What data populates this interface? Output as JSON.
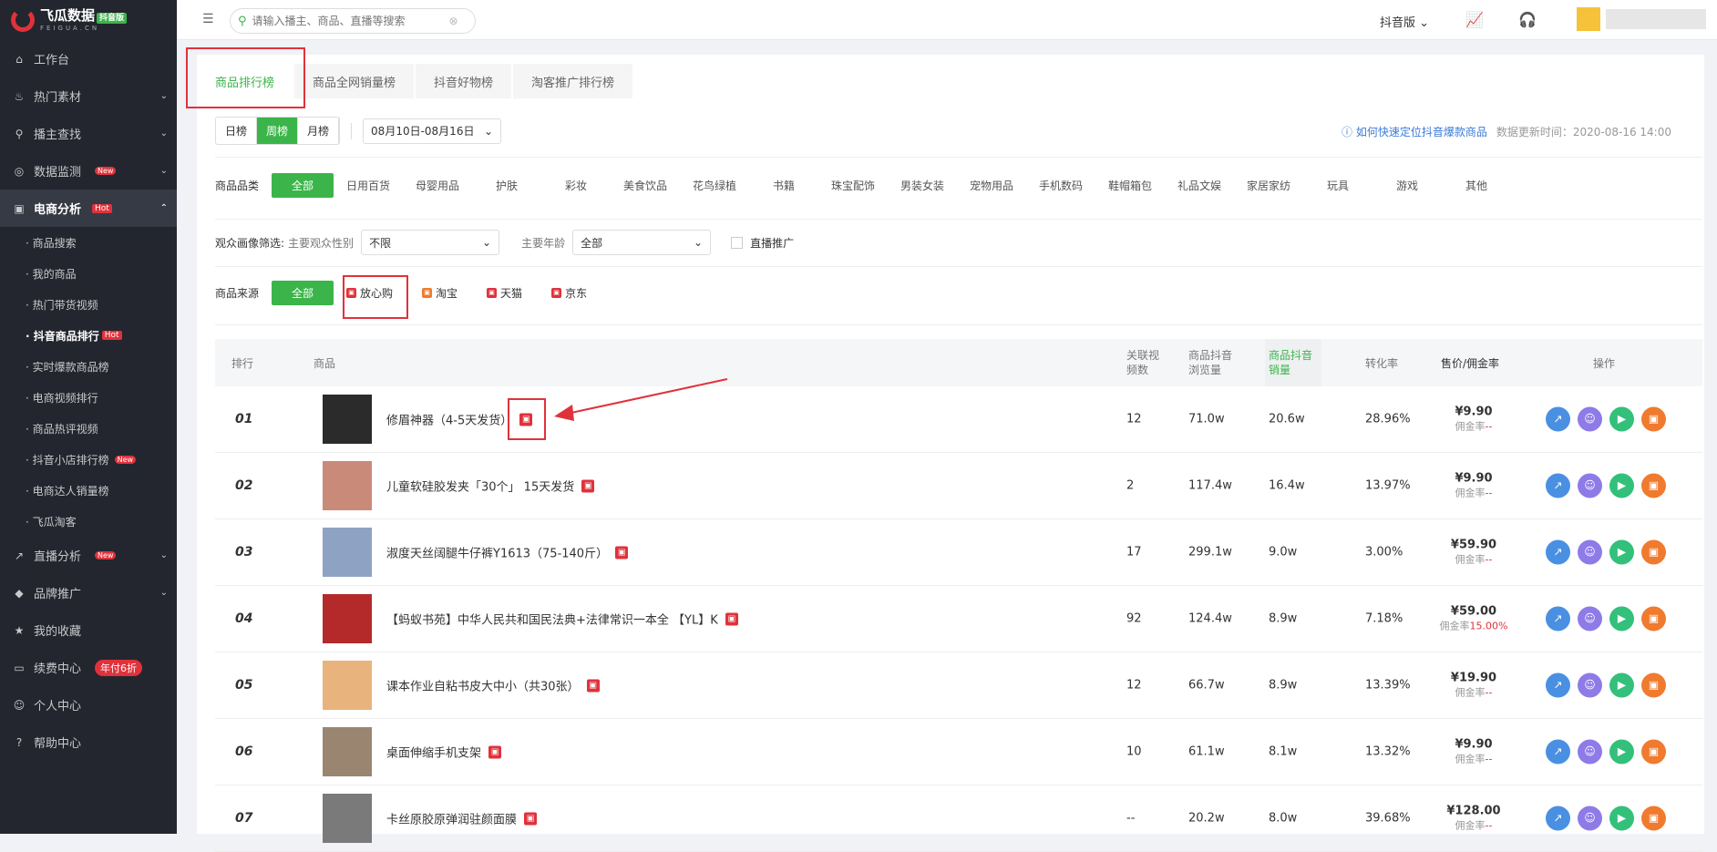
{
  "brand": {
    "name": "飞瓜数据",
    "sub": "FEIGUA.CN",
    "tag": "抖音版"
  },
  "nav": [
    {
      "label": "工作台",
      "icon": "home-icon",
      "glyph": "⌂"
    },
    {
      "label": "热门素材",
      "icon": "fire-icon",
      "glyph": "♨",
      "chev": "⌄"
    },
    {
      "label": "播主查找",
      "icon": "search-icon",
      "glyph": "⚲",
      "chev": "⌄"
    },
    {
      "label": "数据监测",
      "icon": "monitor-icon",
      "glyph": "◎",
      "chev": "⌄",
      "badge": "New"
    }
  ],
  "ecommerce": {
    "label": "电商分析",
    "badge": "Hot",
    "glyph": "▣",
    "chev": "⌃"
  },
  "sub_nav": [
    {
      "label": "· 商品搜索"
    },
    {
      "label": "· 我的商品"
    },
    {
      "label": "· 热门带货视频"
    },
    {
      "label": "· 抖音商品排行",
      "badge": "Hot",
      "active": true
    },
    {
      "label": "· 实时爆款商品榜"
    },
    {
      "label": "· 电商视频排行"
    },
    {
      "label": "· 商品热评视频"
    },
    {
      "label": "· 抖音小店排行榜",
      "badge": "New"
    },
    {
      "label": "· 电商达人销量榜"
    },
    {
      "label": "· 飞瓜淘客"
    }
  ],
  "nav2": [
    {
      "label": "直播分析",
      "icon": "live-icon",
      "glyph": "↗",
      "chev": "⌄",
      "badge": "New"
    },
    {
      "label": "品牌推广",
      "icon": "diamond-icon",
      "glyph": "◆",
      "chev": "⌄"
    },
    {
      "label": "我的收藏",
      "icon": "star-icon",
      "glyph": "★"
    },
    {
      "label": "续费中心",
      "icon": "card-icon",
      "glyph": "▭",
      "disc": "年付6折"
    },
    {
      "label": "个人中心",
      "icon": "user-icon",
      "glyph": "☺"
    },
    {
      "label": "帮助中心",
      "icon": "help-icon",
      "glyph": "?"
    }
  ],
  "search": {
    "placeholder": "请输入播主、商品、直播等搜索"
  },
  "platform": "抖音版",
  "tabs": [
    "商品排行榜",
    "商品全网销量榜",
    "抖音好物榜",
    "淘客推广排行榜"
  ],
  "period": {
    "options": [
      "日榜",
      "周榜",
      "月榜"
    ],
    "selected": "周榜",
    "range": "08月10日-08月16日"
  },
  "help_link": "如何快速定位抖音爆款商品",
  "update_time": "数据更新时间：2020-08-16 14:00",
  "category": {
    "label": "商品品类",
    "all": "全部",
    "items": [
      "日用百货",
      "母婴用品",
      "护肤",
      "彩妆",
      "美食饮品",
      "花鸟绿植",
      "书籍",
      "珠宝配饰",
      "男装女装",
      "宠物用品",
      "手机数码",
      "鞋帽箱包",
      "礼品文娱",
      "家居家纺",
      "玩具",
      "游戏",
      "其他"
    ]
  },
  "audience": {
    "label": "观众画像筛选:",
    "gender_label": "主要观众性别",
    "gender": "不限",
    "age_label": "主要年龄",
    "age": "全部",
    "live_label": "直播推广"
  },
  "source": {
    "label": "商品来源",
    "all": "全部",
    "items": [
      "放心购",
      "淘宝",
      "天猫",
      "京东"
    ]
  },
  "columns": {
    "rank": "排行",
    "product": "商品",
    "videos": "关联视频数",
    "views": "商品抖音浏览量",
    "sales": "商品抖音销量",
    "conv": "转化率",
    "price": "售价/佣金率",
    "ops": "操作"
  },
  "commission_label": "佣金率",
  "rows": [
    {
      "rank": "01",
      "name": "修眉神器（4-5天发货）",
      "videos": "12",
      "views": "71.0w",
      "sales": "20.6w",
      "conv": "28.96%",
      "price": "¥9.90",
      "rate": "--",
      "thumb": "#2b2b2b"
    },
    {
      "rank": "02",
      "name": "儿童软硅胶发夹「30个」 15天发货",
      "videos": "2",
      "views": "117.4w",
      "sales": "16.4w",
      "conv": "13.97%",
      "price": "¥9.90",
      "rate": "--",
      "thumb": "#c98a7a"
    },
    {
      "rank": "03",
      "name": "淑度天丝阔腿牛仔裤Y1613（75-140斤）",
      "videos": "17",
      "views": "299.1w",
      "sales": "9.0w",
      "conv": "3.00%",
      "price": "¥59.90",
      "rate": "--",
      "thumb": "#8ea3c4"
    },
    {
      "rank": "04",
      "name": "【蚂蚁书苑】中华人民共和国民法典+法律常识一本全 【YL】K",
      "videos": "92",
      "views": "124.4w",
      "sales": "8.9w",
      "conv": "7.18%",
      "price": "¥59.00",
      "rate": "15.00%",
      "thumb": "#b42a2a"
    },
    {
      "rank": "05",
      "name": "课本作业自粘书皮大中小（共30张）",
      "videos": "12",
      "views": "66.7w",
      "sales": "8.9w",
      "conv": "13.39%",
      "price": "¥19.90",
      "rate": "--",
      "thumb": "#e8b37d"
    },
    {
      "rank": "06",
      "name": "桌面伸缩手机支架",
      "videos": "10",
      "views": "61.1w",
      "sales": "8.1w",
      "conv": "13.32%",
      "price": "¥9.90",
      "rate": "--",
      "thumb": "#9a8670"
    },
    {
      "rank": "07",
      "name": "卡丝原胶原弹润驻颜面膜",
      "videos": "--",
      "views": "20.2w",
      "sales": "8.0w",
      "conv": "39.68%",
      "price": "¥128.00",
      "rate": "--",
      "thumb": "#7a7a7a"
    }
  ],
  "ops": [
    {
      "icon": "trend-icon",
      "glyph": "↗",
      "color": "#4a90e2"
    },
    {
      "icon": "user-circle-icon",
      "glyph": "☺",
      "color": "#8e7be8"
    },
    {
      "icon": "play-icon",
      "glyph": "▶",
      "color": "#33c07a"
    },
    {
      "icon": "shop-icon",
      "glyph": "▣",
      "color": "#f07a2e"
    }
  ]
}
